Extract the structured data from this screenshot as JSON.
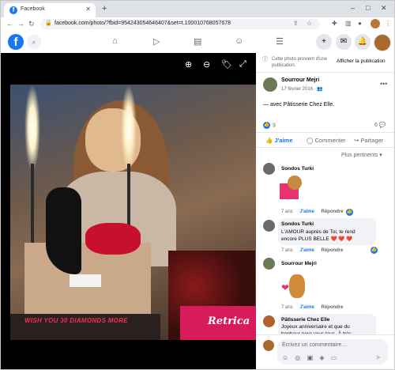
{
  "browser": {
    "tab_title": "Facebook",
    "favicon_letter": "f",
    "new_tab": "+",
    "url": "facebook.com/photo/?fbid=954243054646407&set=t.100010768057678",
    "window_controls": [
      "–",
      "□",
      "✕"
    ]
  },
  "fb": {
    "logo_letter": "f",
    "search_icon": "⌕",
    "nav_icons": [
      "⌂",
      "▷",
      "▤",
      "☺",
      "☰"
    ],
    "right_buttons": [
      "+",
      "✉",
      "🔔"
    ]
  },
  "photo": {
    "cake_text": "WISH YOU 30 DIAMONDS MORE",
    "watermark": "Retrica",
    "controls": [
      "⊕",
      "⊖",
      "🏷",
      "⤢"
    ]
  },
  "post": {
    "source_info": "Cette photo provient d'une publication.",
    "source_link": "Afficher la publication",
    "author": "Sourrour Mejri",
    "date": "17 février 2016 · 👥",
    "caption": "— avec Pâtisserie Chez Elle.",
    "like_count": "9",
    "comment_count": "6",
    "actions": {
      "like": "J'aime",
      "comment": "Commenter",
      "share": "Partager"
    },
    "sort_label": "Plus pertinents ▾"
  },
  "comments": [
    {
      "author": "Sondos Turki",
      "text": "",
      "age": "7 ans",
      "like": "J'aime",
      "reply": "Répondre"
    },
    {
      "author": "Sondos Turki",
      "text": "L'AMOUR auprès de Toi, te rend encore PLUS BELLE ❤️ ❤️ ❤️",
      "age": "7 ans",
      "like": "J'aime",
      "reply": "Répondre"
    },
    {
      "author": "Sourrour Mejri",
      "text": "",
      "age": "7 ans",
      "like": "J'aime",
      "reply": "Répondre"
    },
    {
      "author": "Pâtisserie Chez Elle",
      "text": "Joyeux anniversaire et que du bonheur pour vous tous. À très",
      "age": "",
      "like": "",
      "reply": ""
    }
  ],
  "composer": {
    "placeholder": "Écrivez un commentaire…",
    "icons": "☺ ◎ ▣ ◈ ▭",
    "send": "➤"
  },
  "colors": {
    "brand": "#1877f2",
    "photo_bg": "#000000"
  }
}
